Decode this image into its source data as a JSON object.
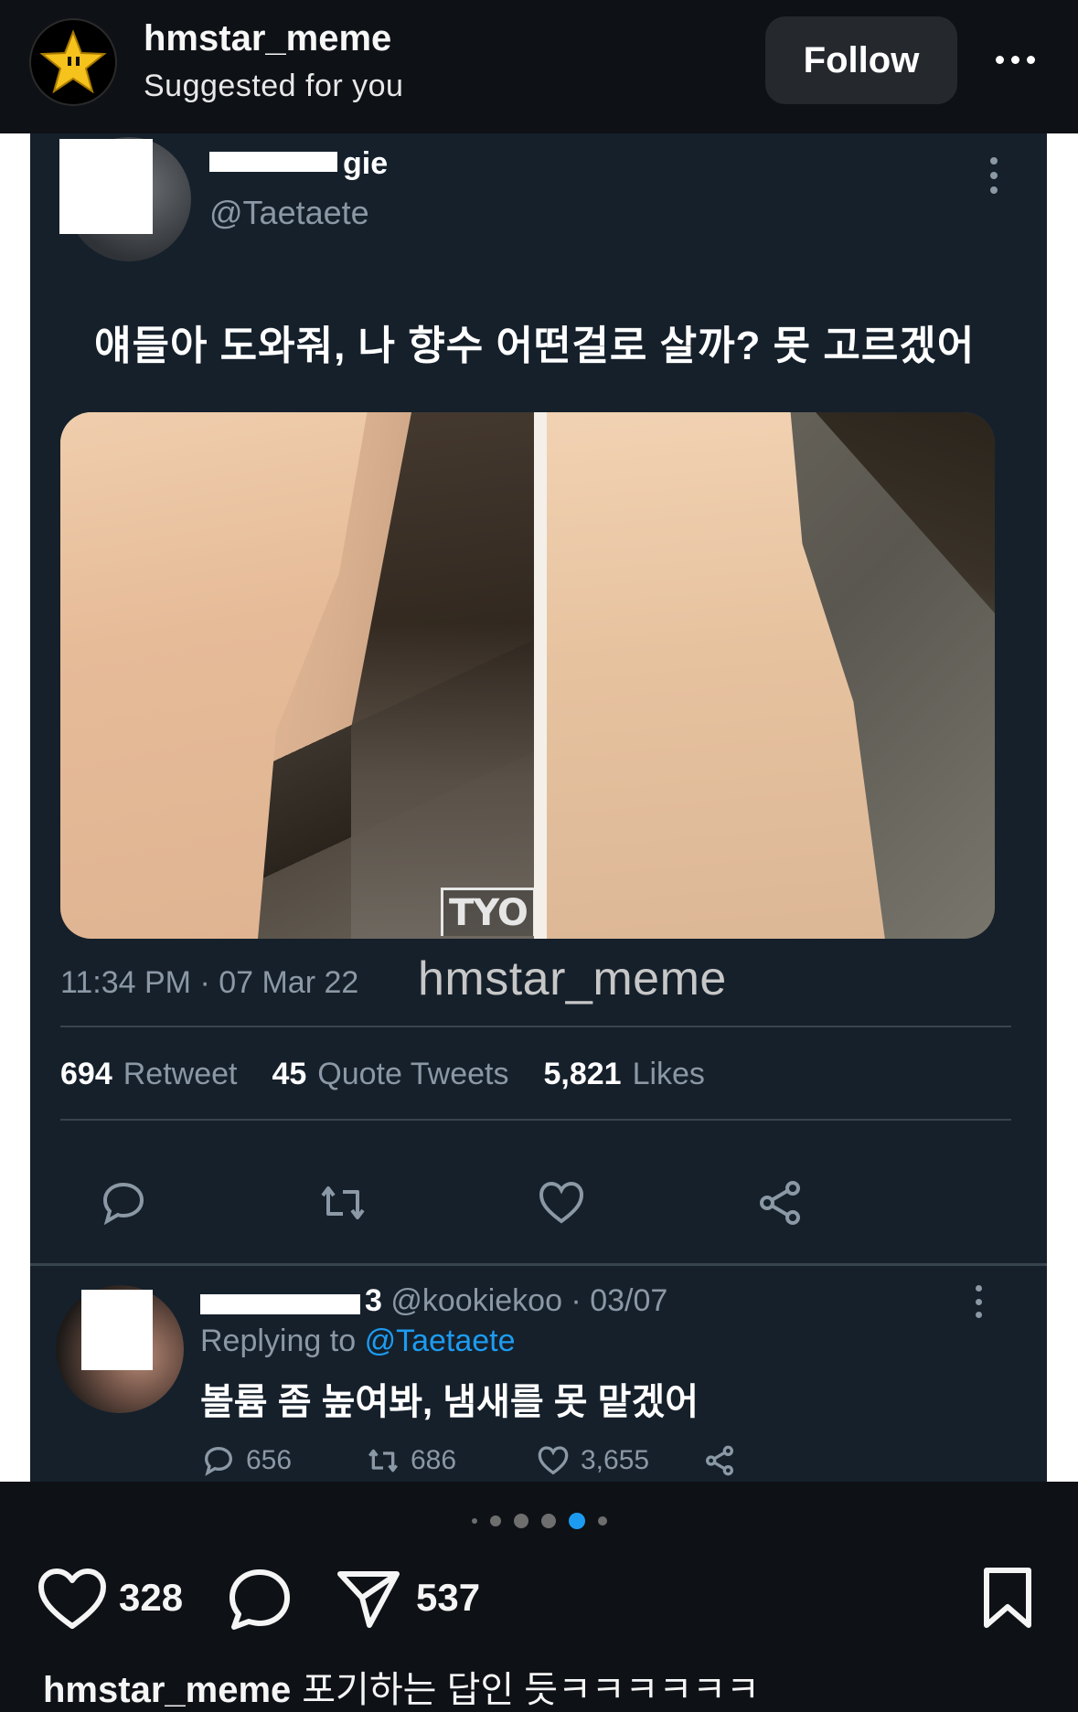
{
  "header": {
    "username": "hmstar_meme",
    "subtitle": "Suggested for you",
    "follow_label": "Follow",
    "avatar_icon": "star-icon",
    "more_icon": "more-horizontal-icon"
  },
  "tweet": {
    "name_visible": "gie",
    "handle": "@Taetaete",
    "text": "얘들아 도와줘, 나 향수 어떤걸로 살까? 못 고르겠어",
    "image_watermark": "TYO",
    "timestamp": "11:34 PM · 07 Mar 22",
    "overlay_watermark": "hmstar_meme",
    "stats": [
      {
        "count": "694",
        "label": "Retweet"
      },
      {
        "count": "45",
        "label": "Quote Tweets"
      },
      {
        "count": "5,821",
        "label": "Likes"
      }
    ],
    "action_icons": [
      "reply-icon",
      "retweet-icon",
      "like-icon",
      "share-icon"
    ]
  },
  "reply": {
    "name_suffix": "3",
    "handle_date": "@kookiekoo · 03/07",
    "replying_prefix": "Replying to",
    "replying_to": "@Taetaete",
    "text": "볼륨 좀 높여봐, 냄새를 못 맡겠어",
    "counts": {
      "replies": "656",
      "retweets": "686",
      "likes": "3,655"
    }
  },
  "carousel": {
    "total": 6,
    "active_index": 4,
    "active_color": "#1d9bf0"
  },
  "post_actions": {
    "likes": "328",
    "shares": "537",
    "icons": [
      "heart-icon",
      "comment-icon",
      "share-send-icon",
      "bookmark-icon"
    ]
  },
  "caption": {
    "username": "hmstar_meme",
    "text": "포기하는 답인 듯ㅋㅋㅋㅋㅋㅋ"
  }
}
